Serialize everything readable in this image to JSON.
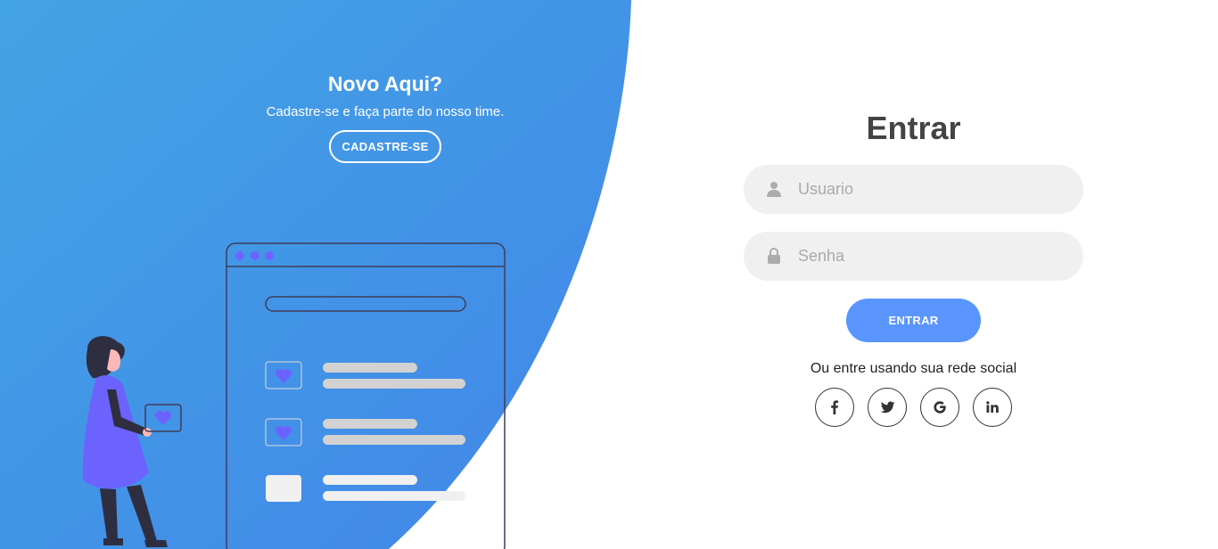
{
  "signup_panel": {
    "title": "Novo Aqui?",
    "subtitle": "Cadastre-se e faça parte do nosso time.",
    "button_label": "CADASTRE-SE"
  },
  "login_form": {
    "title": "Entrar",
    "username_placeholder": "Usuario",
    "password_placeholder": "Senha",
    "submit_label": "ENTRAR",
    "social_text": "Ou entre usando sua rede social",
    "social_networks": [
      "facebook-icon",
      "twitter-icon",
      "google-icon",
      "linkedin-icon"
    ]
  },
  "colors": {
    "gradient_start": "#43a4e3",
    "gradient_end": "#4285ea",
    "primary_button": "#5995fd",
    "illustration_accent": "#6c63ff",
    "title_text": "#444444",
    "input_background": "#f0f0f0"
  }
}
